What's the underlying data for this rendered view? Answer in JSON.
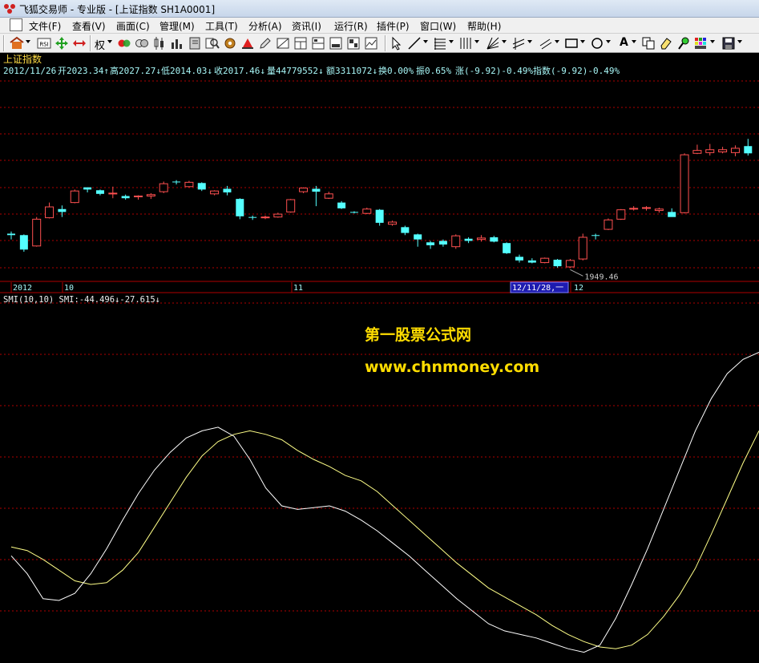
{
  "window": {
    "title": "飞狐交易师 - 专业版 - [上证指数 SH1A0001]"
  },
  "menu": [
    {
      "label": "文件(F)"
    },
    {
      "label": "查看(V)"
    },
    {
      "label": "画面(C)"
    },
    {
      "label": "管理(M)"
    },
    {
      "label": "工具(T)"
    },
    {
      "label": "分析(A)"
    },
    {
      "label": "资讯(I)"
    },
    {
      "label": "运行(R)"
    },
    {
      "label": "插件(P)"
    },
    {
      "label": "窗口(W)"
    },
    {
      "label": "帮助(H)"
    }
  ],
  "toolbar": {
    "rsi_label": "RSI",
    "quan_label": "权",
    "text_tool_label": "A"
  },
  "main_panel": {
    "title": "上证指数",
    "info_line": {
      "date": "2012/11/26",
      "open": "开2023.34↑",
      "high": "高2027.27↓",
      "low": "低2014.03↓",
      "close": "收2017.46↓",
      "volume": "量44779552↓",
      "amount": "额3311072↓",
      "turnover": "换0.00%",
      "amplitude": "振0.65%",
      "change": "涨(-9.92)-0.49%",
      "index": "指数(-9.92)-0.49%"
    },
    "low_label": "1949.46"
  },
  "date_axis": {
    "year": "2012",
    "oct": "10",
    "nov": "11",
    "cursor_date": "12/11/28,一",
    "dec": "12"
  },
  "indicator": {
    "header": "SMI(10,10) SMI:-44.496↓-27.615↓"
  },
  "watermark": {
    "line1": "第一股票公式网",
    "line2": "www.chnmoney.com"
  },
  "colors": {
    "up": "#ff5050",
    "down": "#54ffff",
    "grid": "#b00000",
    "smi": "#ffffff",
    "signal": "#ffff88",
    "watermark": "#ffdd00",
    "info": "#a8f8f8",
    "title": "#ffdd44"
  },
  "chart_data": {
    "type": "candlestick",
    "series": [
      {
        "o": 1997,
        "h": 2000,
        "l": 1989,
        "c": 1995
      },
      {
        "o": 1995,
        "h": 1996,
        "l": 1972,
        "c": 1975
      },
      {
        "o": 1980,
        "h": 2020,
        "l": 1979,
        "c": 2017
      },
      {
        "o": 2019,
        "h": 2040,
        "l": 2018,
        "c": 2034
      },
      {
        "o": 2031,
        "h": 2036,
        "l": 2020,
        "c": 2027
      },
      {
        "o": 2040,
        "h": 2058,
        "l": 2039,
        "c": 2056
      },
      {
        "o": 2061,
        "h": 2061,
        "l": 2054,
        "c": 2058
      },
      {
        "o": 2057,
        "h": 2058,
        "l": 2050,
        "c": 2052
      },
      {
        "o": 2053,
        "h": 2062,
        "l": 2046,
        "c": 2053
      },
      {
        "o": 2049,
        "h": 2051,
        "l": 2044,
        "c": 2046
      },
      {
        "o": 2048,
        "h": 2050,
        "l": 2044,
        "c": 2049
      },
      {
        "o": 2049,
        "h": 2053,
        "l": 2045,
        "c": 2051
      },
      {
        "o": 2055,
        "h": 2069,
        "l": 2053,
        "c": 2066
      },
      {
        "o": 2069,
        "h": 2071,
        "l": 2065,
        "c": 2068
      },
      {
        "o": 2062,
        "h": 2070,
        "l": 2061,
        "c": 2068
      },
      {
        "o": 2067,
        "h": 2068,
        "l": 2056,
        "c": 2058
      },
      {
        "o": 2052,
        "h": 2057,
        "l": 2050,
        "c": 2056
      },
      {
        "o": 2059,
        "h": 2063,
        "l": 2050,
        "c": 2054
      },
      {
        "o": 2045,
        "h": 2046,
        "l": 2017,
        "c": 2021
      },
      {
        "o": 2020,
        "h": 2022,
        "l": 2016,
        "c": 2019
      },
      {
        "o": 2019,
        "h": 2022,
        "l": 2017,
        "c": 2020
      },
      {
        "o": 2020,
        "h": 2026,
        "l": 2019,
        "c": 2024
      },
      {
        "o": 2027,
        "h": 2045,
        "l": 2026,
        "c": 2044
      },
      {
        "o": 2055,
        "h": 2061,
        "l": 2053,
        "c": 2060
      },
      {
        "o": 2059,
        "h": 2063,
        "l": 2035,
        "c": 2055
      },
      {
        "o": 2046,
        "h": 2055,
        "l": 2045,
        "c": 2052
      },
      {
        "o": 2040,
        "h": 2042,
        "l": 2031,
        "c": 2032
      },
      {
        "o": 2027,
        "h": 2028,
        "l": 2025,
        "c": 2026
      },
      {
        "o": 2025,
        "h": 2033,
        "l": 2024,
        "c": 2031
      },
      {
        "o": 2030,
        "h": 2031,
        "l": 2008,
        "c": 2012
      },
      {
        "o": 2010,
        "h": 2015,
        "l": 2008,
        "c": 2013
      },
      {
        "o": 2006,
        "h": 2008,
        "l": 1995,
        "c": 1998
      },
      {
        "o": 1996,
        "h": 1997,
        "l": 1979,
        "c": 1989
      },
      {
        "o": 1985,
        "h": 1987,
        "l": 1976,
        "c": 1981
      },
      {
        "o": 1987,
        "h": 1989,
        "l": 1979,
        "c": 1982
      },
      {
        "o": 1979,
        "h": 1996,
        "l": 1976,
        "c": 1994
      },
      {
        "o": 1990,
        "h": 1992,
        "l": 1984,
        "c": 1987
      },
      {
        "o": 1989,
        "h": 1995,
        "l": 1986,
        "c": 1991
      },
      {
        "o": 1992,
        "h": 1994,
        "l": 1985,
        "c": 1986
      },
      {
        "o": 1984,
        "h": 1985,
        "l": 1969,
        "c": 1970
      },
      {
        "o": 1965,
        "h": 1968,
        "l": 1957,
        "c": 1960
      },
      {
        "o": 1960,
        "h": 1963,
        "l": 1956,
        "c": 1957
      },
      {
        "o": 1957,
        "h": 1964,
        "l": 1956,
        "c": 1963
      },
      {
        "o": 1961,
        "h": 1962,
        "l": 1950,
        "c": 1952
      },
      {
        "o": 1951,
        "h": 1962,
        "l": 1949.46,
        "c": 1960
      },
      {
        "o": 1962,
        "h": 1997,
        "l": 1960,
        "c": 1992
      },
      {
        "o": 1995,
        "h": 1997,
        "l": 1989,
        "c": 1994
      },
      {
        "o": 2003,
        "h": 2018,
        "l": 2002,
        "c": 2016
      },
      {
        "o": 2017,
        "h": 2031,
        "l": 2016,
        "c": 2030
      },
      {
        "o": 2031,
        "h": 2035,
        "l": 2029,
        "c": 2032
      },
      {
        "o": 2032,
        "h": 2035,
        "l": 2029,
        "c": 2033
      },
      {
        "o": 2029,
        "h": 2033,
        "l": 2026,
        "c": 2031
      },
      {
        "o": 2027,
        "h": 2032,
        "l": 2026,
        "c": 2020
      },
      {
        "o": 2026,
        "h": 2108,
        "l": 2025,
        "c": 2106
      },
      {
        "o": 2108,
        "h": 2120,
        "l": 2107,
        "c": 2112
      },
      {
        "o": 2109,
        "h": 2121,
        "l": 2105,
        "c": 2113
      },
      {
        "o": 2110,
        "h": 2117,
        "l": 2108,
        "c": 2113
      },
      {
        "o": 2109,
        "h": 2119,
        "l": 2104,
        "c": 2115
      },
      {
        "o": 2118,
        "h": 2128,
        "l": 2105,
        "c": 2108
      }
    ],
    "smi": [
      -30,
      -40,
      -54,
      -55,
      -51,
      -40,
      -26,
      -10,
      5,
      18,
      28,
      36,
      40,
      42,
      37,
      24,
      8,
      -2,
      -4,
      -3,
      -2,
      -5,
      -10,
      -16,
      -23,
      -30,
      -38,
      -46,
      -54,
      -61,
      -68,
      -72,
      -74,
      -76,
      -79,
      -82,
      -84,
      -80,
      -65,
      -46,
      -26,
      -4,
      18,
      40,
      58,
      72,
      80,
      84
    ],
    "signal": [
      -25,
      -27,
      -32,
      -38,
      -44,
      -46,
      -45,
      -38,
      -28,
      -14,
      0,
      14,
      26,
      34,
      38,
      40,
      38,
      35,
      29,
      24,
      20,
      15,
      12,
      6,
      -2,
      -10,
      -18,
      -26,
      -34,
      -41,
      -48,
      -53,
      -58,
      -63,
      -69,
      -74,
      -78,
      -81,
      -82,
      -80,
      -74,
      -64,
      -52,
      -37,
      -18,
      2,
      22,
      40
    ]
  }
}
